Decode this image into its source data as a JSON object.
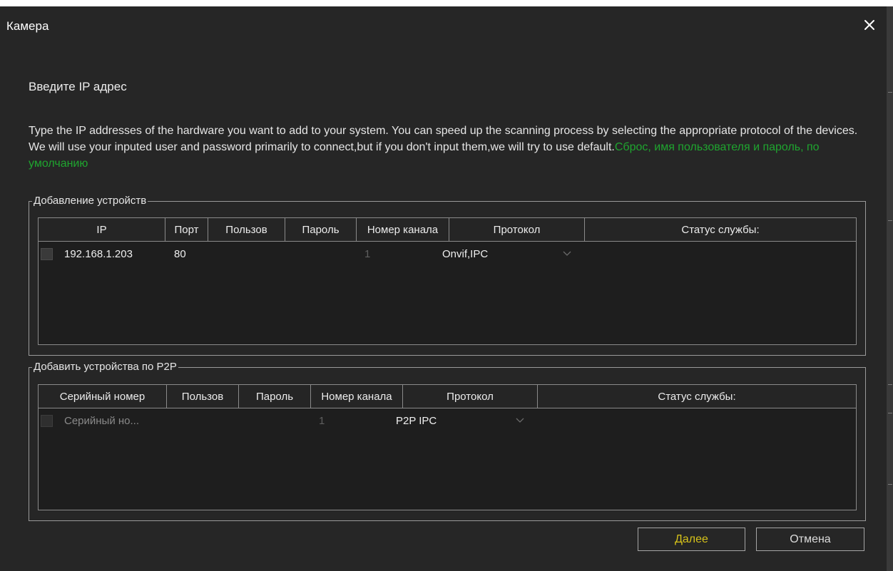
{
  "window": {
    "title": "Камера",
    "close_icon": "close-icon"
  },
  "heading": "Введите IP адрес",
  "description": {
    "text": "Type the IP addresses of the hardware you want to add to your system. You can speed up the scanning process by selecting the appropriate protocol of the devices. We will use your inputed user and password primarily to connect,but if you don't input them,we will try to use default.",
    "link": "Сброс, имя пользователя и пароль, по умолчанию",
    "link_color": "#1fa52f"
  },
  "ip_group": {
    "title": "Добавление устройств",
    "columns": [
      "IP",
      "Порт",
      "Пользов",
      "Пароль",
      "Номер канала",
      "Протокол",
      "Статус службы:"
    ],
    "rows": [
      {
        "checked": false,
        "ip": "192.168.1.203",
        "port": "80",
        "user": "",
        "password": "",
        "channel": "1",
        "protocol": "Onvif,IPC",
        "status": ""
      }
    ]
  },
  "p2p_group": {
    "title": "Добавить устройства  по P2P",
    "columns": [
      "Серийный номер",
      "Пользов",
      "Пароль",
      "Номер канала",
      "Протокол",
      "Статус службы:"
    ],
    "rows": [
      {
        "checked": false,
        "serial_placeholder": "Серийный но...",
        "user": "",
        "password": "",
        "channel": "1",
        "protocol": "P2P IPC",
        "status": ""
      }
    ]
  },
  "buttons": {
    "next": "Далее",
    "cancel": "Отмена",
    "next_color": "#d6c21a"
  },
  "colors": {
    "background": "#262626",
    "table_bg": "#1e1e1e",
    "border": "#8a8a8a"
  }
}
